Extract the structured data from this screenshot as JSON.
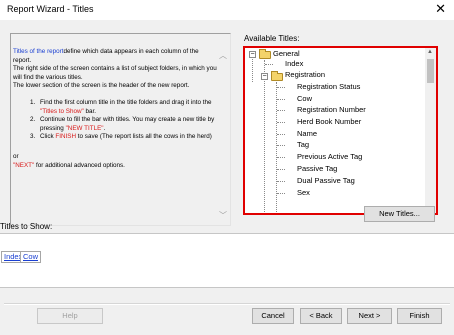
{
  "window": {
    "title": "Report Wizard - Titles",
    "close_glyph": "✕"
  },
  "instructions": {
    "lead_emph": "Titles of the report",
    "lead_rest": "define which data appears in each column of the report.",
    "p2": "The right side of the screen contains a list of subject folders, in which you will find the various titles.",
    "p3": "The lower section of the screen is the header of the new report.",
    "step1_a": "Find the first column title in the title folders and drag it into the ",
    "step1_b": "\"Titles to Show\"",
    "step1_c": " bar.",
    "step2_a": "Continue to fill the bar with titles. You may create a new title by pressing ",
    "step2_b": "\"NEW TITLE\"",
    "step2_c": ".",
    "step3_a": "Click ",
    "step3_b": "FINISH",
    "step3_c": " to save (The report lists all the cows in the herd)",
    "or": "or",
    "next_b": "\"NEXT\"",
    "next_c": " for additional advanced options."
  },
  "available": {
    "label": "Available Titles:",
    "general": "General",
    "index": "Index",
    "registration": "Registration",
    "items": [
      "Registration Status",
      "Cow",
      "Registration Number",
      "Herd Book Number",
      "Name",
      "Tag",
      "Previous Active Tag",
      "Passive Tag",
      "Dual Passive Tag",
      "Sex"
    ]
  },
  "new_titles_label": "New Titles...",
  "titles_to_show": {
    "label": "Titles to Show:",
    "chips": [
      "Index",
      "Cow"
    ]
  },
  "footer": {
    "help": "Help",
    "cancel": "Cancel",
    "back": "< Back",
    "next": "Next >",
    "finish": "Finish"
  }
}
